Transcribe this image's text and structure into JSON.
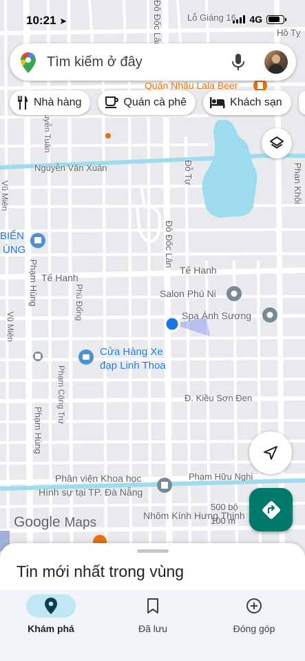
{
  "status_bar": {
    "time": "10:21",
    "network": "4G",
    "battery_fraction": 0.8
  },
  "search": {
    "placeholder": "Tìm kiếm ở đây"
  },
  "chips": [
    {
      "label": "Nhà hàng",
      "icon": "restaurant-icon"
    },
    {
      "label": "Quán cà phê",
      "icon": "coffee-icon"
    },
    {
      "label": "Khách sạn",
      "icon": "hotel-icon"
    }
  ],
  "map": {
    "streets": {
      "lo_giang": "Lỗ Giáng 16",
      "ho_ty": "Hồ Tỵ",
      "nguyen_van_xuan": "Nguyễn Văn Xuân",
      "do_tu": "Đỗ Tự",
      "phan_khoi": "Phan Khôi",
      "do_doc_lan_top": "Đô Đốc Lân",
      "do_doc_lan": "Đô Đốc Lân",
      "te_hanh_left": "Tế Hanh",
      "te_hanh_right": "Tế Hanh",
      "pham_hung_1": "Phạm Hùng",
      "pham_hung_2": "Phạm Hùng",
      "phu_dong": "Phù Đổng",
      "vu_mien_1": "Vũ Miên",
      "vu_mien_2": "Vũ Miên",
      "pham_cong_tru": "Phạm Công Trứ",
      "kieu_son_den": "Đ. Kiều Sơn Đen",
      "pham_huu_nghi": "Phạm Hữu Nghi",
      "nguyen_tuan": "Nguyễn Tuân"
    },
    "places": {
      "quan_nhau": "Quán Nhậu Lala Beer",
      "salon": "Salon Phú Ni",
      "spa": "Spa Ánh Sương",
      "cua_hang_1": "Cửa Hàng Xe",
      "cua_hang_2": "đạp Linh Thoa",
      "phan_vien_1": "Phân viện Khoa học",
      "phan_vien_2": "Hình sự tại TP. Đà Nẵng",
      "nhom_kinh": "Nhôm Kính Hưng Thịnh",
      "bien_1": "BIỂN",
      "bien_2": "ÙNG"
    },
    "scale": {
      "label1": "500 bộ",
      "label2": "100 m"
    },
    "logo_google": "Google",
    "logo_maps": "Maps",
    "colors": {
      "water": "#9cdcee",
      "road": "#ffffff",
      "land": "#e9eaee",
      "blue_dot": "#1a73e8"
    }
  },
  "sheet": {
    "title": "Tin mới nhất trong vùng"
  },
  "nav": [
    {
      "label": "Khám phá",
      "icon": "explore-pin-icon",
      "active": true
    },
    {
      "label": "Đã lưu",
      "icon": "bookmark-icon",
      "active": false
    },
    {
      "label": "Đóng góp",
      "icon": "add-circle-icon",
      "active": false
    }
  ]
}
